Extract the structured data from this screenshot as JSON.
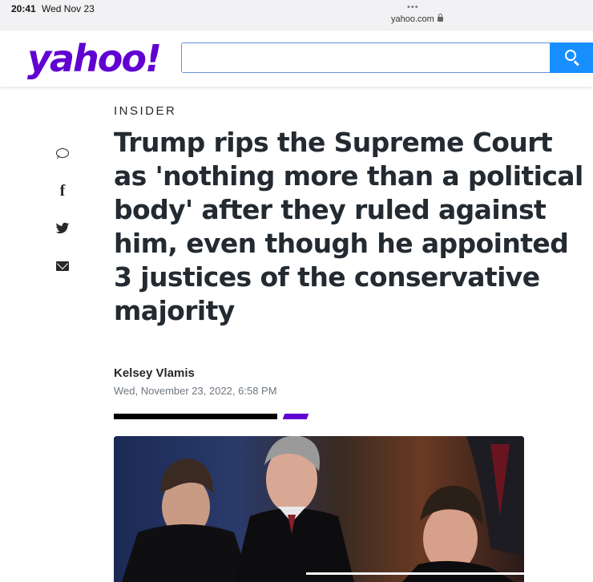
{
  "status_bar": {
    "time": "20:41",
    "date": "Wed Nov 23",
    "dots": "•••",
    "url": "yahoo.com"
  },
  "header": {
    "logo": "yahoo!",
    "search": {
      "value": "",
      "placeholder": ""
    }
  },
  "share_rail": [
    "comment-icon",
    "facebook-icon",
    "twitter-icon",
    "mail-icon"
  ],
  "article": {
    "publisher": "INSIDER",
    "headline": "Trump rips the Supreme Court as 'nothing more than a political body' after they ruled against him, even though he appointed 3 justices of the conservative majority",
    "author": "Kelsey Vlamis",
    "date": "Wed, November 23, 2022, 6:58 PM"
  },
  "colors": {
    "brand": "#6001d2",
    "search_button": "#188fff",
    "text": "#232a31",
    "accent_bar": "#5f01d1"
  }
}
